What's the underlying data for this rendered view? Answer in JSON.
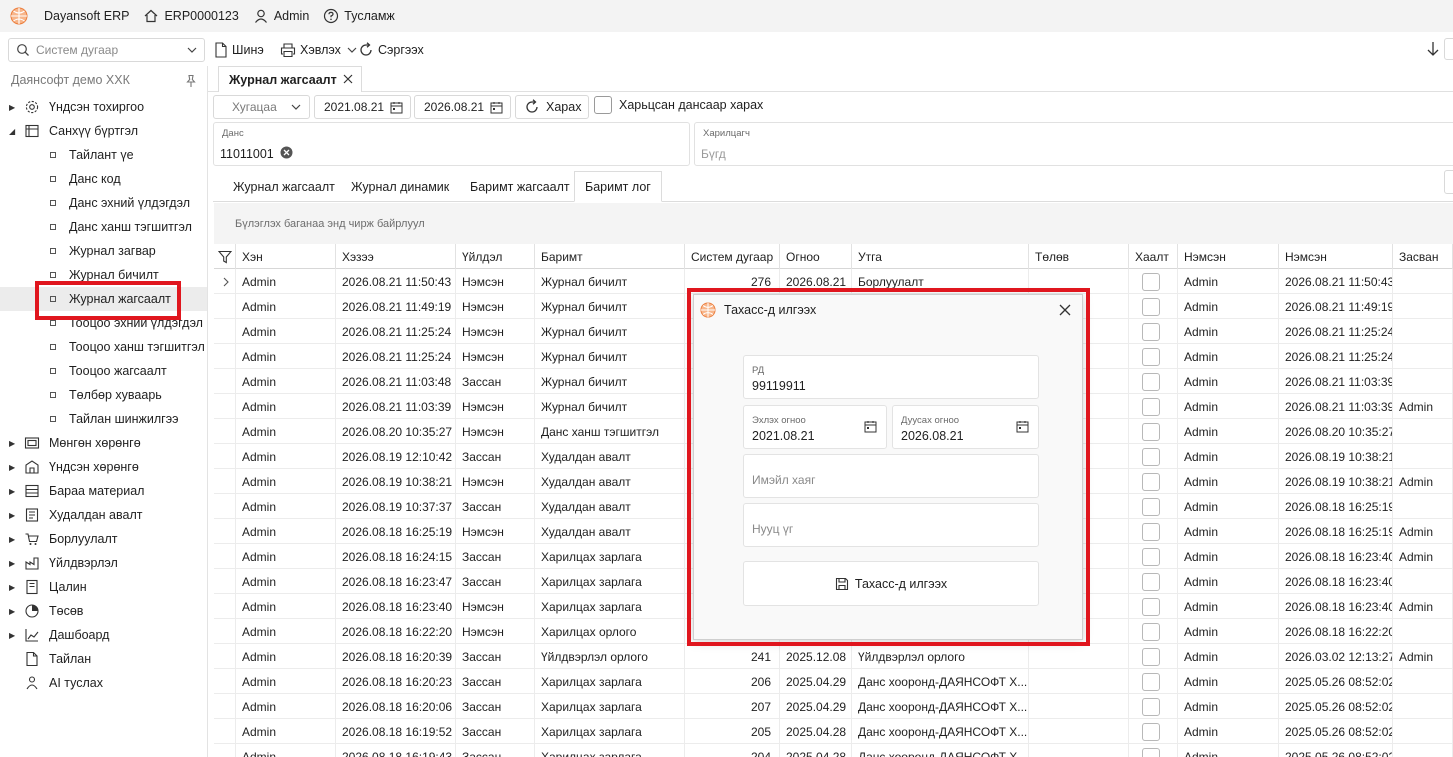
{
  "titlebar": {
    "app_name": "Dayansoft ERP",
    "doc_code": "ERP0000123",
    "user": "Admin",
    "help": "Тусламж"
  },
  "toolbar": {
    "search_placeholder": "Систем дугаар",
    "new_label": "Шинэ",
    "print_label": "Хэвлэх",
    "refresh_label": "Сэргээх"
  },
  "sidebar": {
    "company": "Даянсофт демо ХХК",
    "items": [
      {
        "label": "Үндсэн тохиргоо",
        "icon": "gear-icon",
        "expanded": false
      },
      {
        "label": "Санхүү бүртгэл",
        "icon": "ledger-icon",
        "expanded": true
      },
      {
        "label": "Тайлант үе",
        "sub": true
      },
      {
        "label": "Данс код",
        "sub": true
      },
      {
        "label": "Данс эхний үлдэгдэл",
        "sub": true
      },
      {
        "label": "Данс ханш тэгшитгэл",
        "sub": true
      },
      {
        "label": "Журнал загвар",
        "sub": true
      },
      {
        "label": "Журнал бичилт",
        "sub": true
      },
      {
        "label": "Журнал жагсаалт",
        "sub": true,
        "selected": true
      },
      {
        "label": "Тооцоо эхний үлдэгдэл",
        "sub": true
      },
      {
        "label": "Тооцоо ханш тэгшитгэл",
        "sub": true
      },
      {
        "label": "Тооцоо жагсаалт",
        "sub": true
      },
      {
        "label": "Төлбөр хуваарь",
        "sub": true
      },
      {
        "label": "Тайлан шинжилгээ",
        "sub": true
      },
      {
        "label": "Мөнгөн хөрөнгө",
        "icon": "cash-icon"
      },
      {
        "label": "Үндсэн хөрөнгө",
        "icon": "asset-icon"
      },
      {
        "label": "Бараа материал",
        "icon": "inventory-icon"
      },
      {
        "label": "Худалдан авалт",
        "icon": "purchase-icon"
      },
      {
        "label": "Борлуулалт",
        "icon": "sales-icon"
      },
      {
        "label": "Үйлдвэрлэл",
        "icon": "production-icon"
      },
      {
        "label": "Цалин",
        "icon": "payroll-icon"
      },
      {
        "label": "Төсөв",
        "icon": "budget-icon"
      },
      {
        "label": "Дашбоард",
        "icon": "dashboard-icon"
      },
      {
        "label": "Тайлан",
        "icon": "report-icon",
        "leaf": true
      },
      {
        "label": "AI туслах",
        "icon": "ai-icon",
        "leaf": true
      }
    ]
  },
  "doc_tab": {
    "label": "Журнал жагсаалт"
  },
  "filters": {
    "period_placeholder": "Хугацаа",
    "date_from": "2021.08.21",
    "date_to": "2026.08.21",
    "view_label": "Харах",
    "by_account_label": "Харьцсан дансаар харах",
    "account_caption": "Данс",
    "account_value": "11011001",
    "partner_caption": "Харилцагч",
    "partner_placeholder": "Бүгд"
  },
  "inner_tabs": [
    "Журнал жагсаалт",
    "Журнал динамик",
    "Баримт жагсаалт",
    "Баримт лог"
  ],
  "inner_tab_active": 3,
  "grid": {
    "group_hint": "Бүлэглэх баганаа энд чирж байрлуул",
    "columns": [
      "Хэн",
      "Хэзээ",
      "Үйлдэл",
      "Баримт",
      "Систем дугаар",
      "Огноо",
      "Утга",
      "Төлөв",
      "Хаалт",
      "Нэмсэн",
      "Нэмсэн",
      "Засван"
    ],
    "rows": [
      [
        "Admin",
        "2026.08.21 11:50:43",
        "Нэмсэн",
        "Журнал бичилт",
        "276",
        "2026.08.21",
        "Борлуулалт",
        "",
        "",
        "Admin",
        "2026.08.21 11:50:43",
        ""
      ],
      [
        "Admin",
        "2026.08.21 11:49:19",
        "Нэмсэн",
        "Журнал бичилт",
        "",
        "",
        "",
        "",
        "",
        "Admin",
        "2026.08.21 11:49:19",
        ""
      ],
      [
        "Admin",
        "2026.08.21 11:25:24",
        "Нэмсэн",
        "Журнал бичилт",
        "",
        "",
        "",
        "",
        "",
        "Admin",
        "2026.08.21 11:25:24",
        ""
      ],
      [
        "Admin",
        "2026.08.21 11:25:24",
        "Нэмсэн",
        "Журнал бичилт",
        "",
        "",
        "",
        "",
        "",
        "Admin",
        "2026.08.21 11:25:24",
        ""
      ],
      [
        "Admin",
        "2026.08.21 11:03:48",
        "Зассан",
        "Журнал бичилт",
        "",
        "",
        "",
        "",
        "",
        "Admin",
        "2026.08.21 11:03:39",
        ""
      ],
      [
        "Admin",
        "2026.08.21 11:03:39",
        "Нэмсэн",
        "Журнал бичилт",
        "",
        "",
        "",
        "",
        "",
        "Admin",
        "2026.08.21 11:03:39",
        "Admin"
      ],
      [
        "Admin",
        "2026.08.20 10:35:27",
        "Нэмсэн",
        "Данс ханш тэгшитгэл",
        "",
        "",
        "",
        "",
        "",
        "Admin",
        "2026.08.20 10:35:27",
        ""
      ],
      [
        "Admin",
        "2026.08.19 12:10:42",
        "Зассан",
        "Худалдан авалт",
        "",
        "",
        "",
        "",
        "",
        "Admin",
        "2026.08.19 10:38:21",
        ""
      ],
      [
        "Admin",
        "2026.08.19 10:38:21",
        "Нэмсэн",
        "Худалдан авалт",
        "",
        "",
        "",
        "",
        "",
        "Admin",
        "2026.08.19 10:38:21",
        "Admin"
      ],
      [
        "Admin",
        "2026.08.19 10:37:37",
        "Зассан",
        "Худалдан авалт",
        "",
        "",
        "",
        "",
        "",
        "Admin",
        "2026.08.18 16:25:19",
        ""
      ],
      [
        "Admin",
        "2026.08.18 16:25:19",
        "Нэмсэн",
        "Худалдан авалт",
        "",
        "",
        "",
        "",
        "",
        "Admin",
        "2026.08.18 16:25:19",
        "Admin"
      ],
      [
        "Admin",
        "2026.08.18 16:24:15",
        "Зассан",
        "Харилцах зарлага",
        "",
        "",
        "",
        "",
        "",
        "Admin",
        "2026.08.18 16:23:40",
        "Admin"
      ],
      [
        "Admin",
        "2026.08.18 16:23:47",
        "Зассан",
        "Харилцах зарлага",
        "",
        "",
        "",
        "",
        "",
        "Admin",
        "2026.08.18 16:23:40",
        ""
      ],
      [
        "Admin",
        "2026.08.18 16:23:40",
        "Нэмсэн",
        "Харилцах зарлага",
        "",
        "",
        "",
        "",
        "",
        "Admin",
        "2026.08.18 16:23:40",
        "Admin"
      ],
      [
        "Admin",
        "2026.08.18 16:22:20",
        "Нэмсэн",
        "Харилцах орлого",
        "",
        "",
        "",
        "",
        "",
        "Admin",
        "2026.08.18 16:22:20",
        ""
      ],
      [
        "Admin",
        "2026.08.18 16:20:39",
        "Зассан",
        "Үйлдвэрлэл орлого",
        "241",
        "2025.12.08",
        "Үйлдвэрлэл орлого",
        "",
        "",
        "Admin",
        "2026.03.02 12:13:27",
        "Admin"
      ],
      [
        "Admin",
        "2026.08.18 16:20:23",
        "Зассан",
        "Харилцах зарлага",
        "206",
        "2025.04.29",
        "Данс хооронд-ДАЯНСОФТ Х...",
        "",
        "",
        "Admin",
        "2025.05.26 08:52:02",
        ""
      ],
      [
        "Admin",
        "2026.08.18 16:20:06",
        "Зассан",
        "Харилцах зарлага",
        "207",
        "2025.04.29",
        "Данс хооронд-ДАЯНСОФТ Х...",
        "",
        "",
        "Admin",
        "2025.05.26 08:52:02",
        ""
      ],
      [
        "Admin",
        "2026.08.18 16:19:52",
        "Зассан",
        "Харилцах зарлага",
        "205",
        "2025.04.28",
        "Данс хооронд-ДАЯНСОФТ Х...",
        "",
        "",
        "Admin",
        "2025.05.26 08:52:02",
        ""
      ],
      [
        "Admin",
        "2026.08.18 16:19:43",
        "Зассан",
        "Харилцах зарлага",
        "204",
        "2025.04.28",
        "Данс хооронд-ДАЯНСОФТ Х...",
        "",
        "",
        "Admin",
        "2025.05.26 08:52:02",
        ""
      ]
    ]
  },
  "dialog": {
    "title": "Тахасс-д илгээх",
    "rd_caption": "РД",
    "rd_value": "99119911",
    "start_caption": "Эхлэх огноо",
    "start_value": "2021.08.21",
    "end_caption": "Дуусах огноо",
    "end_value": "2026.08.21",
    "email_placeholder": "Имэйл хаяг",
    "password_placeholder": "Нууц үг",
    "send_label": "Тахасс-д илгээх"
  },
  "colors": {
    "highlight": "#e0161e",
    "logo": "#f0883e"
  }
}
